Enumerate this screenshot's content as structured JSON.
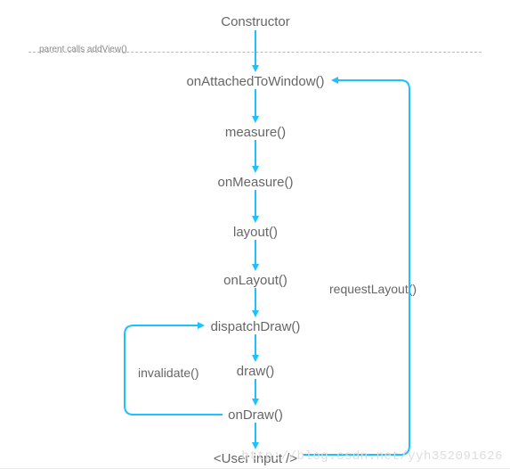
{
  "nodes": {
    "constructor": "Constructor",
    "onAttached": "onAttachedToWindow()",
    "measure": "measure()",
    "onMeasure": "onMeasure()",
    "layout": "layout()",
    "onLayout": "onLayout()",
    "dispatchDraw": "dispatchDraw()",
    "draw": "draw()",
    "onDraw": "onDraw()",
    "userInput": "<User input />"
  },
  "annotations": {
    "parentCalls": "parent calls addView()"
  },
  "labels": {
    "requestLayout": "requestLayout()",
    "invalidate": "invalidate()"
  },
  "watermark": "http://blog.csdn.net/yyh352091626",
  "colors": {
    "arrow": "#1ec0ff"
  }
}
